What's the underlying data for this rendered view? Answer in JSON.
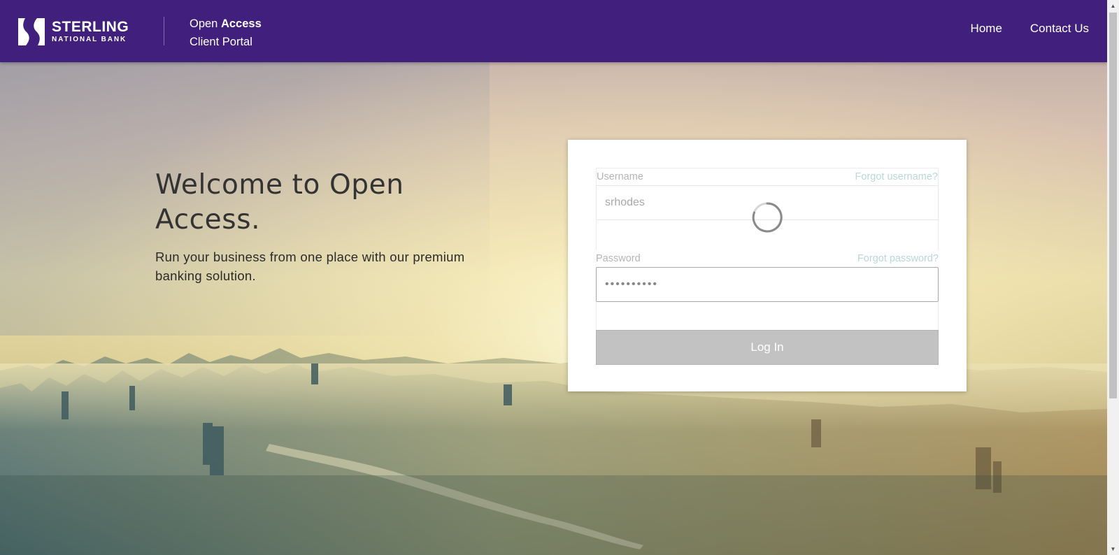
{
  "header": {
    "logo": {
      "name": "STERLING",
      "sub": "NATIONAL BANK"
    },
    "product": {
      "line1_regular": "Open",
      "line1_bold": "Access",
      "line2": "Client Portal"
    },
    "nav": [
      {
        "label": "Home"
      },
      {
        "label": "Contact Us"
      }
    ]
  },
  "hero": {
    "title": "Welcome to Open Access.",
    "subtitle": "Run your business from one place with our premium banking solution."
  },
  "login": {
    "username_label": "Username",
    "forgot_username": "Forgot username?",
    "username_value": "srhodes",
    "password_label": "Password",
    "forgot_password": "Forgot password?",
    "password_value": "••••••••••",
    "submit_label": "Log In",
    "loading": true
  },
  "colors": {
    "header_bg": "#41207d",
    "button_disabled": "#c2c2c2",
    "link": "#b8d9d6"
  },
  "icons": {
    "logo": "sterling-s-logo-icon",
    "spinner": "loading-spinner-icon"
  }
}
